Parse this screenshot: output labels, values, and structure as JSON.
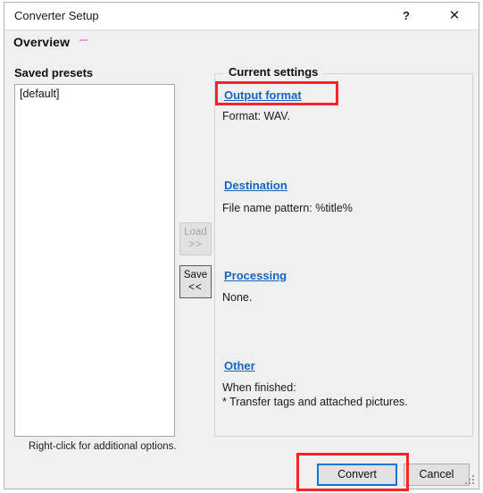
{
  "window": {
    "title": "Converter Setup",
    "help_label": "?",
    "close_label": "✕"
  },
  "header": {
    "title": "Overview"
  },
  "presets": {
    "label": "Saved presets",
    "items": [
      "[default]"
    ],
    "hint": "Right-click for additional options."
  },
  "transfer_buttons": {
    "load": {
      "line1": "Load",
      "line2": ">>",
      "enabled": false
    },
    "save": {
      "line1": "Save",
      "line2": "<<",
      "enabled": true
    }
  },
  "current_settings": {
    "legend": "Current settings",
    "sections": [
      {
        "link": "Output format",
        "text": "Format: WAV."
      },
      {
        "link": "Destination",
        "text": "File name pattern: %title%"
      },
      {
        "link": "Processing",
        "text": "None."
      },
      {
        "link": "Other",
        "text": "When finished:\n* Transfer tags and attached pictures."
      }
    ]
  },
  "footer": {
    "convert_label": "Convert",
    "cancel_label": "Cancel"
  },
  "colors": {
    "link": "#1763c4",
    "focus_ring": "#0078d7",
    "annotation": "#fc2424",
    "dialog_face": "#f0f0f0",
    "accent_dash": "#e79bdd"
  }
}
